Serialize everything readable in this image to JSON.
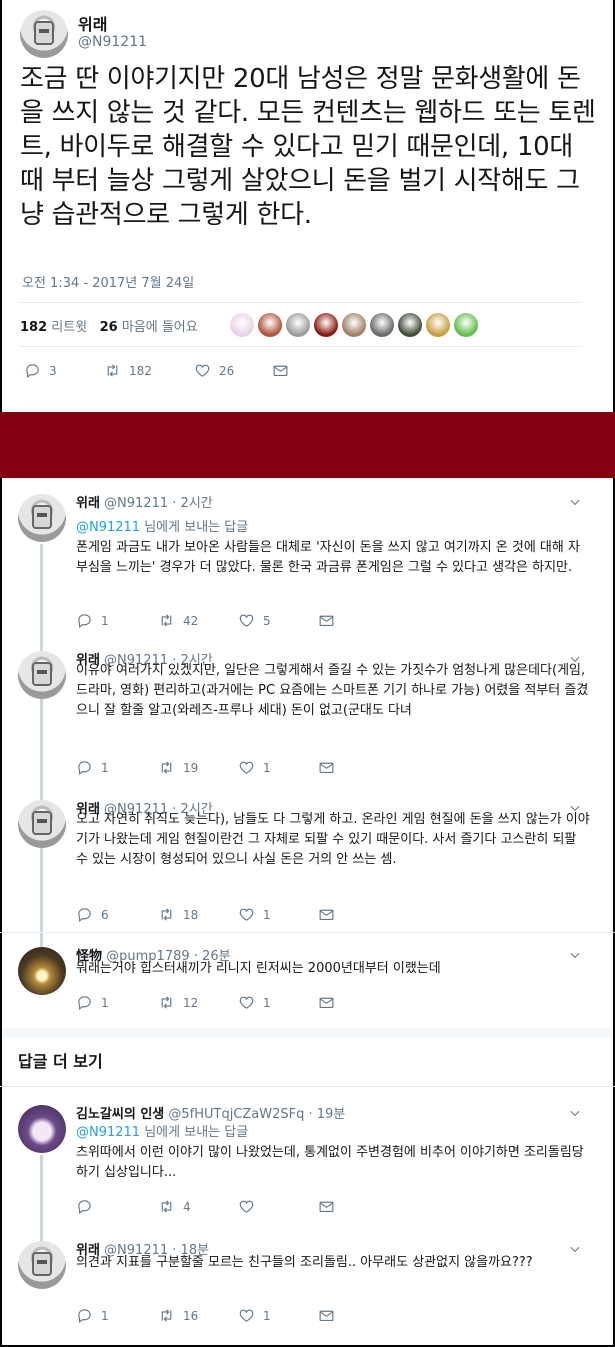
{
  "main": {
    "name": "위래",
    "handle": "@N91211",
    "text": "조금 딴 이야기지만 20대 남성은 정말 문화생활에 돈을 쓰지 않는 것 같다. 모든 컨텐츠는 웹하드 또는 토렌트, 바이두로 해결할 수 있다고 믿기 때문인데, 10대 때 부터 늘상 그렇게 살았으니 돈을 벌기 시작해도 그냥 습관적으로 그렇게 한다.",
    "time": "오전 1:34 - 2017년 7월 24일",
    "retweet_count": "182",
    "retweet_label": "리트윗",
    "like_count": "26",
    "like_label": "마음에 들어요",
    "actions": {
      "reply": "3",
      "retweet": "182",
      "like": "26"
    }
  },
  "liker_colors": [
    "#e9d3e6",
    "#b2543c",
    "#9c9c9c",
    "#8a1a10",
    "#a08264",
    "#6a6a6a",
    "#3f4f3a",
    "#c7a03e",
    "#62c04d"
  ],
  "replying_to_label": "님에게 보내는 답글",
  "replies": [
    {
      "name": "위래",
      "handle": "@N91211",
      "time": "· 2시간",
      "to": "@N91211",
      "text": "폰게임 과금도 내가 보아온 사람들은 대체로 '자신이 돈을 쓰지 않고 여기까지 온 것에 대해 자부심을 느끼는' 경우가 더 많았다. 물론 한국 과금류 폰게임은 그럴 수 있다고 생각은 하지만.",
      "reply": "1",
      "retweet": "42",
      "like": "5"
    },
    {
      "name": "위래",
      "handle": "@N91211",
      "time": "· 2시간",
      "text": "이유야 여러가지 있겠지만, 일단은 그렇게해서 즐길 수 있는 가짓수가 엄청나게 많은데다(게임, 드라마, 영화) 편리하고(과거에는 PC 요즘에는 스마트폰 기기 하나로 가능) 어렸을 적부터 즐겼으니 잘 할줄 알고(와레즈-프루나 세대) 돈이 없고(군대도 다녀",
      "reply": "1",
      "retweet": "19",
      "like": "1"
    },
    {
      "name": "위래",
      "handle": "@N91211",
      "time": "· 2시간",
      "text": "오고 자연히 취직도 늦는다), 남들도 다 그렇게 하고. 온라인 게임 현질에 돈을 쓰지 않는가 이야기가 나왔는데 게임 현질이란건 그 자체로 되팔 수 있기 때문이다. 사서 즐기다 고스란히 되팔 수 있는 시장이 형성되어 있으니 사실 돈은 거의 안 쓰는 셈.",
      "reply": "6",
      "retweet": "18",
      "like": "1"
    },
    {
      "name": "怪物",
      "handle": "@pump1789",
      "time": "· 26분",
      "text": "뭐래는거야 힙스터새끼가 리니지 린저씨는 2000년대부터 이랬는데",
      "reply": "1",
      "retweet": "12",
      "like": "1"
    }
  ],
  "more_replies_label": "답글 더 보기",
  "more": [
    {
      "name": "김노갈씨의 인생",
      "handle": "@5fHUTqjCZaW2SFq",
      "time": "· 19분",
      "to": "@N91211",
      "text": "츠위따에서 이런 이야기 많이 나왔었는데, 통계없이 주변경험에 비추어 이야기하면 조리돌림당하기 십상입니다...",
      "reply": "",
      "retweet": "4",
      "like": ""
    },
    {
      "name": "위래",
      "handle": "@N91211",
      "time": "· 18분",
      "text": "의견과 지표를 구분할줄 모르는 친구들의 조리돌림.. 아무래도 상관없지 않을까요???",
      "reply": "1",
      "retweet": "16",
      "like": "1"
    }
  ]
}
